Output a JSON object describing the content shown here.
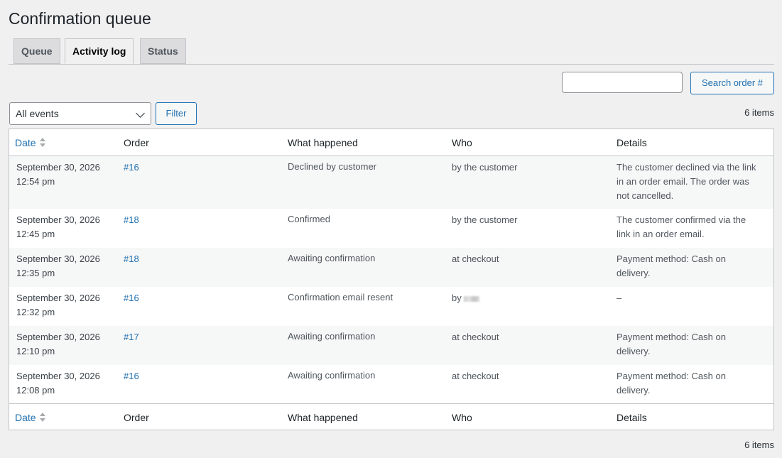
{
  "page": {
    "title": "Confirmation queue"
  },
  "tabs": [
    {
      "label": "Queue",
      "active": false
    },
    {
      "label": "Activity log",
      "active": true
    },
    {
      "label": "Status",
      "active": false
    }
  ],
  "search": {
    "value": "",
    "placeholder": "",
    "button_label": "Search order #"
  },
  "filter": {
    "selected": "All events",
    "button_label": "Filter"
  },
  "item_count": "6 items",
  "table": {
    "columns": [
      "Date",
      "Order",
      "What happened",
      "Who",
      "Details"
    ],
    "rows": [
      {
        "date_line1": "September 30, 2026",
        "date_line2": "12:54 pm",
        "order": "#16",
        "what": "Declined by customer",
        "who": "by the customer",
        "details": [
          "The customer declined via the link",
          "in an order email. The order was",
          "not cancelled."
        ]
      },
      {
        "date_line1": "September 30, 2026",
        "date_line2": "12:45 pm",
        "order": "#18",
        "what": "Confirmed",
        "who": "by the customer",
        "details": [
          "The customer confirmed via the",
          "link in an order email."
        ]
      },
      {
        "date_line1": "September 30, 2026",
        "date_line2": "12:35 pm",
        "order": "#18",
        "what": "Awaiting confirmation",
        "who": "at checkout",
        "details": [
          "Payment method: Cash on",
          "delivery."
        ]
      },
      {
        "date_line1": "September 30, 2026",
        "date_line2": "12:32 pm",
        "order": "#16",
        "what": "Confirmation email resent",
        "who": "by",
        "who_redacted": true,
        "details": [
          "–"
        ]
      },
      {
        "date_line1": "September 30, 2026",
        "date_line2": "12:10 pm",
        "order": "#17",
        "what": "Awaiting confirmation",
        "who": "at checkout",
        "details": [
          "Payment method: Cash on",
          "delivery."
        ]
      },
      {
        "date_line1": "September 30, 2026",
        "date_line2": "12:08 pm",
        "order": "#16",
        "what": "Awaiting confirmation",
        "who": "at checkout",
        "details": [
          "Payment method: Cash on",
          "delivery."
        ]
      }
    ]
  },
  "colors": {
    "link": "#2271b1",
    "stripe": "#f6f7f7",
    "page_bg": "#f0f0f1"
  }
}
